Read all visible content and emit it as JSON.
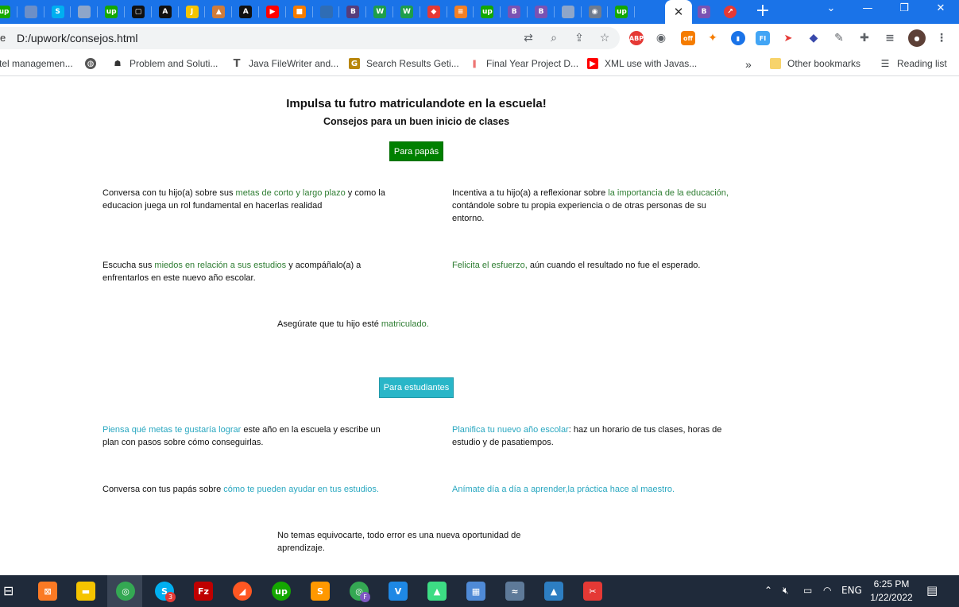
{
  "browser": {
    "tabs": [
      {
        "icon": "upwork-icon",
        "label": "up",
        "color": "#14a800"
      },
      {
        "icon": "loading-icon",
        "label": "",
        "color": "#6c8fc7"
      },
      {
        "icon": "skype-icon",
        "label": "S",
        "color": "#00aff0"
      },
      {
        "icon": "globe-icon",
        "label": "",
        "color": "#8ea6c9"
      },
      {
        "icon": "upwork-icon",
        "label": "up",
        "color": "#14a800"
      },
      {
        "icon": "square-icon",
        "label": "▢",
        "color": "#111111"
      },
      {
        "icon": "a-logo-icon",
        "label": "A",
        "color": "#111111"
      },
      {
        "icon": "j-icon",
        "label": "J",
        "color": "#f5c400"
      },
      {
        "icon": "triangle-icon",
        "label": "▲",
        "color": "#d07c3a"
      },
      {
        "icon": "a-logo-icon",
        "label": "A",
        "color": "#111111"
      },
      {
        "icon": "youtube-icon",
        "label": "▶",
        "color": "#ff0000"
      },
      {
        "icon": "box-icon",
        "label": "■",
        "color": "#f57c00"
      },
      {
        "icon": "circle-icon",
        "label": "",
        "color": "#2f6db5"
      },
      {
        "icon": "bootstrap-icon",
        "label": "B",
        "color": "#563d7c"
      },
      {
        "icon": "w-icon",
        "label": "W",
        "color": "#1e9e4a"
      },
      {
        "icon": "w-icon",
        "label": "W",
        "color": "#1e9e4a"
      },
      {
        "icon": "diamond-icon",
        "label": "◆",
        "color": "#e53935"
      },
      {
        "icon": "stack-icon",
        "label": "≡",
        "color": "#f48024"
      },
      {
        "icon": "upwork-icon",
        "label": "up",
        "color": "#14a800"
      },
      {
        "icon": "bootstrap-icon",
        "label": "B",
        "color": "#7952b3"
      },
      {
        "icon": "bootstrap-icon",
        "label": "B",
        "color": "#7952b3"
      },
      {
        "icon": "globe-icon",
        "label": "",
        "color": "#8ea6c9"
      },
      {
        "icon": "camera-icon",
        "label": "◉",
        "color": "#6f7c8f"
      },
      {
        "icon": "upwork-icon",
        "label": "up",
        "color": "#14a800"
      }
    ],
    "active_tab_close": "✕",
    "after_tabs": [
      {
        "icon": "bootstrap-icon",
        "label": "B",
        "color": "#7952b3"
      },
      {
        "icon": "pin-icon",
        "label": "↗",
        "color": "#e53935"
      }
    ],
    "new_tab": "+",
    "url_prefix": "e",
    "url": "D:/upwork/consejos.html",
    "bookmarks": [
      {
        "label": "tel managemen...",
        "icon": "",
        "color": "#888888"
      },
      {
        "label": "",
        "icon": "globe-icon",
        "color": "#555555"
      },
      {
        "label": "Problem and Soluti...",
        "icon": "bug-icon",
        "color": "#333333"
      },
      {
        "label": "Java FileWriter and...",
        "icon": "t-icon",
        "color": "#555555"
      },
      {
        "label": "Search Results Geti...",
        "icon": "g-icon",
        "color": "#b8860b"
      },
      {
        "label": "Final Year Project D...",
        "icon": "bars-icon",
        "color": "#e53935"
      },
      {
        "label": "XML use with Javas...",
        "icon": "youtube-icon",
        "color": "#ff0000"
      }
    ],
    "bookmarks_overflow": "»",
    "other_bookmarks": "Other bookmarks",
    "reading_list": "Reading list"
  },
  "page": {
    "title": "Impulsa tu futro matriculandote en la escuela!",
    "subtitle": "Consejos para un buen inicio de clases",
    "parents_button": "Para papás",
    "parents_color": "#008000",
    "parents": {
      "p1": {
        "pre": "Conversa con tu hijo(a) sobre sus ",
        "hl": "metas de corto y largo plazo",
        "post": " y como la educacion juega un rol fundamental en hacerlas realidad"
      },
      "p2": {
        "pre": "Incentiva a tu hijo(a) a reflexionar sobre ",
        "hl": "la importancia de la educación,",
        "post": " contándole sobre tu propia experiencia o de otras personas de su entorno."
      },
      "p3": {
        "pre": "Escucha sus ",
        "hl": "miedos en relación a sus estudios",
        "post": " y acompáñalo(a) a enfrentarlos en este nuevo año escolar."
      },
      "p4": {
        "pre": "",
        "hl": "Felicita el esfuerzo,",
        "post": " aún cuando el resultado no fue el esperado."
      },
      "p5": {
        "pre": "Asegúrate que tu hijo esté ",
        "hl": "matriculado.",
        "post": ""
      }
    },
    "students_button": "Para estudiantes",
    "students_color": "#29b6c8",
    "students": {
      "p1": {
        "pre": "",
        "hl": "Piensa qué metas te gustaría lograr",
        "post": " este año en la escuela y escribe un plan con pasos sobre cómo conseguirlas."
      },
      "p2": {
        "pre": "",
        "hl": "Planifica tu nuevo año escolar",
        "post": ": haz un horario de tus clases, horas de estudio y de pasatiempos."
      },
      "p3": {
        "pre": "Conversa con tus papás sobre ",
        "hl": "cómo te pueden ayudar en tus estudios.",
        "post": ""
      },
      "p4": {
        "pre": "",
        "hl": "Anímate día a día a aprender,la práctica hace al maestro.",
        "post": ""
      },
      "p5": {
        "pre": "No temas equivocarte, todo error es una nueva oportunidad de aprendizaje.",
        "hl": "",
        "post": ""
      }
    }
  },
  "taskbar": {
    "apps": [
      {
        "icon": "xampp-icon",
        "label": "⊠",
        "color": "#fb7a24"
      },
      {
        "icon": "file-explorer-icon",
        "label": "▬",
        "color": "#f5c400"
      },
      {
        "icon": "chrome-icon",
        "label": "◎",
        "color": "#34a853"
      },
      {
        "icon": "skype-icon",
        "label": "S",
        "color": "#00aff0"
      },
      {
        "icon": "filezilla-icon",
        "label": "Fz",
        "color": "#bf0000"
      },
      {
        "icon": "compass-icon",
        "label": "◢",
        "color": "#ff5722"
      },
      {
        "icon": "upwork-icon",
        "label": "up",
        "color": "#14a800"
      },
      {
        "icon": "sublime-icon",
        "label": "S",
        "color": "#ff9800"
      },
      {
        "icon": "chrome-profile-icon",
        "label": "◎",
        "color": "#34a853"
      },
      {
        "icon": "vscode-icon",
        "label": "V",
        "color": "#1e88e5"
      },
      {
        "icon": "android-studio-icon",
        "label": "▲",
        "color": "#3ddc84"
      },
      {
        "icon": "control-panel-icon",
        "label": "▦",
        "color": "#4f8ad6"
      },
      {
        "icon": "mysql-icon",
        "label": "≈",
        "color": "#5e7a99"
      },
      {
        "icon": "photos-icon",
        "label": "▲",
        "color": "#2d7ec2"
      },
      {
        "icon": "snipping-icon",
        "label": "✂",
        "color": "#e53935"
      }
    ],
    "skype_badge": "3",
    "profile_badge": "F",
    "lang": "ENG",
    "time": "6:25 PM",
    "date": "1/22/2022"
  }
}
